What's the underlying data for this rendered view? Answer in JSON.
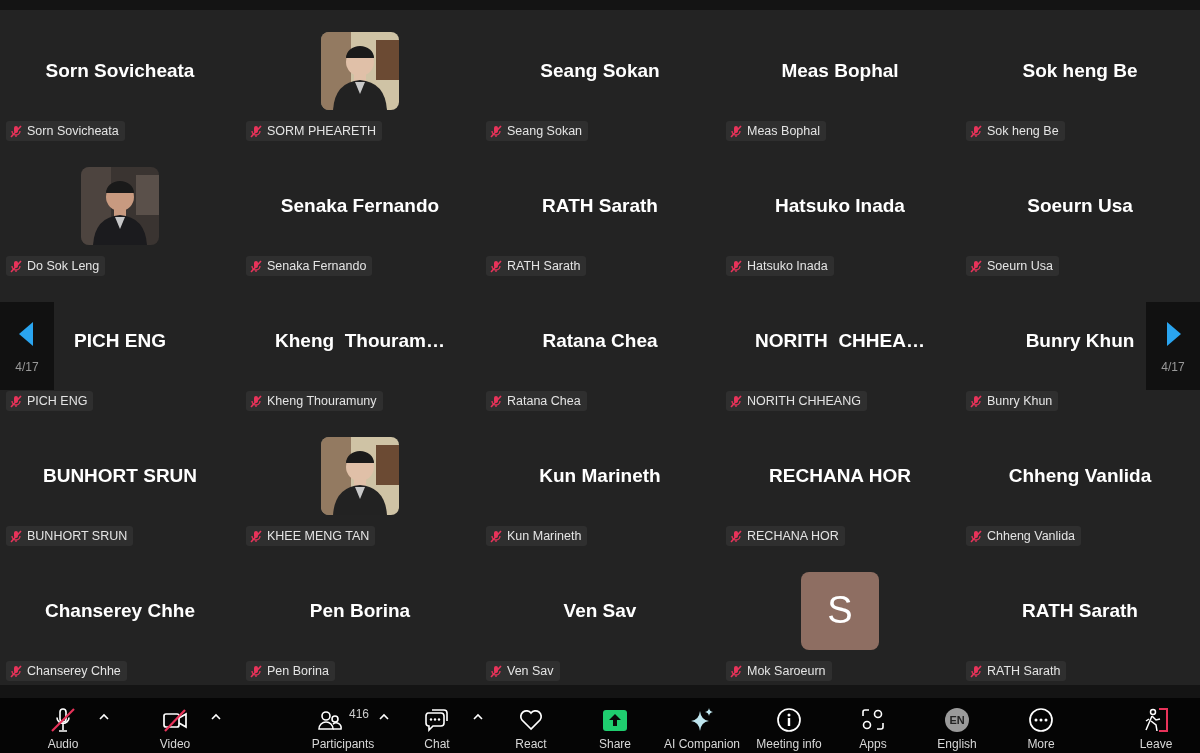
{
  "gallery": {
    "page_indicator_left": "4/17",
    "page_indicator_right": "4/17",
    "tiles": [
      {
        "kind": "name",
        "display": "Sorn Sovicheata",
        "label": "Sorn Sovicheata",
        "muted": true
      },
      {
        "kind": "picture",
        "label": "SORM PHEARETH",
        "muted": true
      },
      {
        "kind": "name",
        "display": "Seang Sokan",
        "label": "Seang Sokan",
        "muted": true
      },
      {
        "kind": "name",
        "display": "Meas Bophal",
        "label": "Meas Bophal",
        "muted": true
      },
      {
        "kind": "name",
        "display": "Sok heng Be",
        "label": "Sok heng Be",
        "muted": true
      },
      {
        "kind": "picture",
        "label": "Do Sok Leng",
        "muted": true
      },
      {
        "kind": "name",
        "display": "Senaka Fernando",
        "label": "Senaka Fernando",
        "muted": true
      },
      {
        "kind": "name",
        "display": "RATH Sarath",
        "label": "RATH Sarath",
        "muted": true
      },
      {
        "kind": "name",
        "display": "Hatsuko Inada",
        "label": "Hatsuko Inada",
        "muted": true
      },
      {
        "kind": "name",
        "display": "Soeurn Usa",
        "label": "Soeurn Usa",
        "muted": true
      },
      {
        "kind": "name",
        "display": "PICH ENG",
        "label": "PICH ENG",
        "muted": true
      },
      {
        "kind": "name",
        "display": "Kheng  Thouram…",
        "label": "Kheng Thouramuny",
        "muted": true
      },
      {
        "kind": "name",
        "display": "Ratana Chea",
        "label": "Ratana Chea",
        "muted": true
      },
      {
        "kind": "name",
        "display": "NORITH  CHHEA…",
        "label": "NORITH CHHEANG",
        "muted": true
      },
      {
        "kind": "name",
        "display": "Bunry Khun",
        "label": "Bunry Khun",
        "muted": true
      },
      {
        "kind": "name",
        "display": "BUNHORT SRUN",
        "label": "BUNHORT SRUN",
        "muted": true
      },
      {
        "kind": "picture",
        "label": "KHEE MENG TAN",
        "muted": true
      },
      {
        "kind": "name",
        "display": "Kun Marineth",
        "label": "Kun Marineth",
        "muted": true
      },
      {
        "kind": "name",
        "display": "RECHANA HOR",
        "label": "RECHANA HOR",
        "muted": true
      },
      {
        "kind": "name",
        "display": "Chheng Vanlida",
        "label": "Chheng Vanlida",
        "muted": true
      },
      {
        "kind": "name",
        "display": "Chanserey Chhe",
        "label": "Chanserey Chhe",
        "muted": true
      },
      {
        "kind": "name",
        "display": "Pen Borina",
        "label": "Pen Borina",
        "muted": true
      },
      {
        "kind": "name",
        "display": "Ven Sav",
        "label": "Ven Sav",
        "muted": true
      },
      {
        "kind": "initial",
        "display": "S",
        "label": "Mok Saroeurn",
        "muted": true
      },
      {
        "kind": "name",
        "display": "RATH Sarath",
        "label": "RATH Sarath",
        "muted": true
      }
    ]
  },
  "toolbar": {
    "left": [
      {
        "kind": "audio",
        "label": "Audio",
        "off": true,
        "caret": true
      },
      {
        "kind": "video",
        "label": "Video",
        "off": true,
        "caret": true
      }
    ],
    "center": [
      {
        "kind": "participants",
        "label": "Participants",
        "count": "416",
        "caret": true
      },
      {
        "kind": "chat",
        "label": "Chat",
        "caret": true
      },
      {
        "kind": "react",
        "label": "React"
      },
      {
        "kind": "share",
        "label": "Share"
      },
      {
        "kind": "ai",
        "label": "AI Companion"
      },
      {
        "kind": "info",
        "label": "Meeting info"
      },
      {
        "kind": "apps",
        "label": "Apps"
      },
      {
        "kind": "language",
        "label": "English",
        "badge": "EN"
      },
      {
        "kind": "more",
        "label": "More"
      }
    ],
    "right": [
      {
        "kind": "leave",
        "label": "Leave"
      }
    ]
  }
}
